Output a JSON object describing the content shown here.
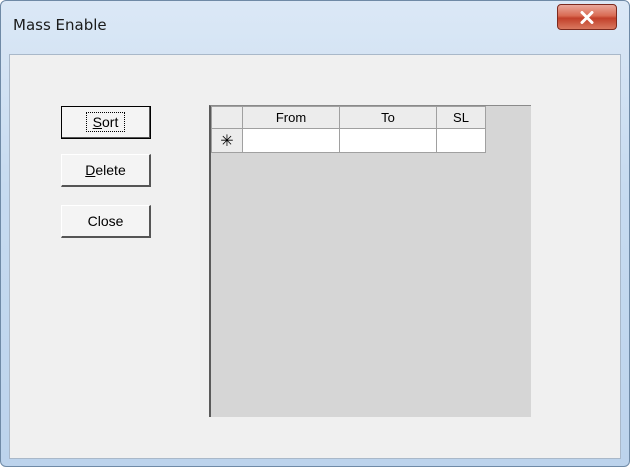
{
  "window": {
    "title": "Mass Enable"
  },
  "buttons": {
    "sort": {
      "label_prefix": "",
      "accel": "S",
      "label_rest": "ort"
    },
    "delete": {
      "label_prefix": "",
      "accel": "D",
      "label_rest": "elete"
    },
    "close": {
      "label": "Close"
    }
  },
  "grid": {
    "columns": [
      "From",
      "To",
      "SL"
    ],
    "new_row_marker": "✳",
    "rows": [
      {
        "from": "",
        "to": "",
        "sl": ""
      }
    ]
  },
  "icons": {
    "window_close": "close-icon",
    "new_row": "asterisk-icon"
  },
  "colors": {
    "close_button": "#c7432c",
    "grid_background": "#d6d6d6",
    "dialog_background": "#f0f0f0"
  }
}
